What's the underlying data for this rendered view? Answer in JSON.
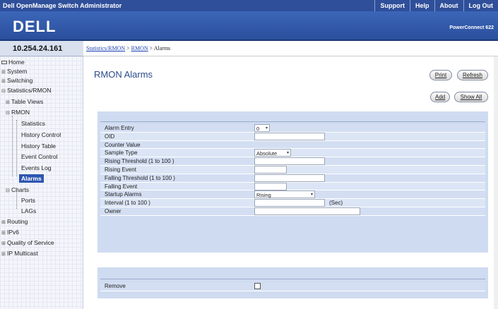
{
  "topbar": {
    "title": "Dell OpenManage Switch Administrator",
    "links": [
      "Support",
      "Help",
      "About",
      "Log Out"
    ]
  },
  "brand": {
    "logo": "DELL",
    "product": "PowerConnect 622"
  },
  "ip": "10.254.24.161",
  "breadcrumb": {
    "link1": "Statistics/RMON",
    "sep1": " > ",
    "link2": "RMON",
    "sep2": " > ",
    "current": "Alarms"
  },
  "sidebar": {
    "home": "Home",
    "system": "System",
    "switching": "Switching",
    "stats": "Statistics/RMON",
    "table_views": "Table Views",
    "rmon": "RMON",
    "statistics": "Statistics",
    "history_control": "History Control",
    "history_table": "History Table",
    "event_control": "Event Control",
    "events_log": "Events Log",
    "alarms": "Alarms",
    "charts": "Charts",
    "ports": "Ports",
    "lags": "LAGs",
    "routing": "Routing",
    "ipv6": "IPv6",
    "qos": "Quality of Service",
    "ip_multicast": "IP Multicast"
  },
  "main": {
    "title": "RMON Alarms",
    "print": "Print",
    "refresh": "Refresh",
    "add": "Add",
    "show_all": "Show All"
  },
  "form": {
    "alarm_entry": {
      "label": "Alarm Entry",
      "value": "0"
    },
    "oid": {
      "label": "OID",
      "value": ""
    },
    "counter_value": {
      "label": "Counter Value"
    },
    "sample_type": {
      "label": "Sample Type",
      "value": "Absolute"
    },
    "rising_threshold": {
      "label": "Rising Threshold (1 to 100 )",
      "value": ""
    },
    "rising_event": {
      "label": "Rising Event",
      "value": ""
    },
    "falling_threshold": {
      "label": "Falling Threshold (1 to 100 )",
      "value": ""
    },
    "falling_event": {
      "label": "Falling Event",
      "value": ""
    },
    "startup_alarms": {
      "label": "Startup Alarms",
      "value": "Rising"
    },
    "interval": {
      "label": "Interval (1 to 100 )",
      "value": "",
      "unit": "(Sec)"
    },
    "owner": {
      "label": "Owner",
      "value": ""
    }
  },
  "remove": {
    "label": "Remove",
    "checked": false
  }
}
